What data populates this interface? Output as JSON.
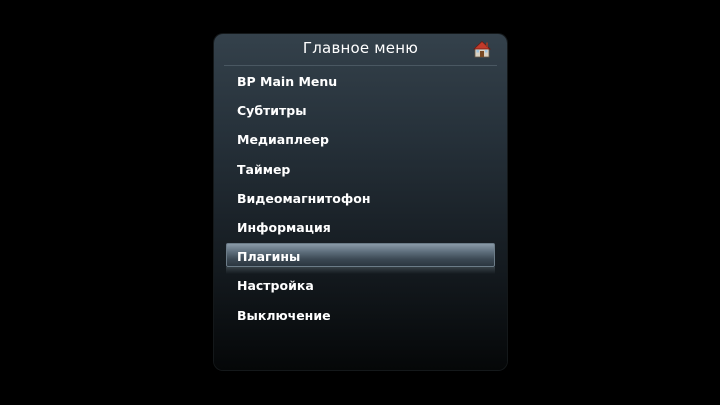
{
  "menu": {
    "title": "Главное меню",
    "home_icon": "home-icon",
    "selected_index": 6,
    "items": [
      {
        "label": "BP Main Menu"
      },
      {
        "label": "Субтитры"
      },
      {
        "label": "Медиаплеер"
      },
      {
        "label": "Таймер"
      },
      {
        "label": "Видеомагнитофон"
      },
      {
        "label": "Информация"
      },
      {
        "label": "Плагины"
      },
      {
        "label": "Настройка"
      },
      {
        "label": "Выключение"
      }
    ]
  },
  "colors": {
    "background": "#000000",
    "panel_top": "#34414b",
    "panel_bottom": "#050708",
    "text": "#ffffff",
    "selection": "#5f6f7d"
  }
}
